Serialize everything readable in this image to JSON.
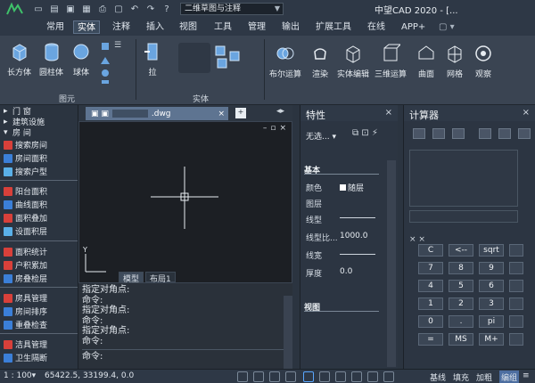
{
  "titlebar": {
    "workspace": "二维草图与注释",
    "app_title": "中望CAD 2020 - [..."
  },
  "menu": {
    "items": [
      "常用",
      "实体",
      "注释",
      "插入",
      "视图",
      "工具",
      "管理",
      "输出",
      "扩展工具",
      "在线",
      "APP+"
    ],
    "active_index": 1
  },
  "ribbon": {
    "primitives": [
      "长方体",
      "圆柱体",
      "球体"
    ],
    "primitives_group": "图元",
    "solid_extrude": "拉",
    "solid_group": "实体",
    "right_buttons": [
      "布尔运算",
      "渲染",
      "实体编辑",
      "三维运算",
      "曲面",
      "网格",
      "观察"
    ]
  },
  "left_palette": {
    "items": [
      "门  窗",
      "建筑设施",
      "房  间",
      "搜索房间",
      "房间面积",
      "搜索户型",
      "阳台面积",
      "曲线面积",
      "面积叠加",
      "设面积层",
      "面积统计",
      "户积累加",
      "房叠检层",
      "房具管理",
      "房间排序",
      "重叠检查",
      "洁具管理",
      "卫生隔断"
    ]
  },
  "document": {
    "tab_label": ".dwg",
    "layout_tabs": [
      "模型",
      "布局1"
    ]
  },
  "command_line": {
    "lines": [
      "指定对角点:",
      "命令:",
      "指定对角点:",
      "命令:",
      "指定对角点:",
      "命令:"
    ],
    "prompt": "命令:"
  },
  "properties": {
    "title": "特性",
    "selection": "无选...",
    "basic_section": "基本",
    "rows": [
      {
        "label": "颜色",
        "value": "随层"
      },
      {
        "label": "图层",
        "value": ""
      },
      {
        "label": "线型",
        "value": ""
      },
      {
        "label": "线型比...",
        "value": "1000.0"
      },
      {
        "label": "线宽",
        "value": ""
      },
      {
        "label": "厚度",
        "value": "0.0"
      }
    ],
    "view_section": "视图"
  },
  "calculator": {
    "title": "计算器",
    "buttons": [
      [
        "C",
        "<--",
        "sqrt"
      ],
      [
        "7",
        "8",
        "9"
      ],
      [
        "4",
        "5",
        "6"
      ],
      [
        "1",
        "2",
        "3"
      ],
      [
        "0",
        ".",
        "pi"
      ],
      [
        "=",
        "MS",
        "M+"
      ]
    ],
    "small_label": "×  ×"
  },
  "statusbar": {
    "scale": "1 : 100",
    "coords": "65422.5, 33199.4, 0.0",
    "right_labels": [
      "基线",
      "填充",
      "加粗",
      "编组"
    ]
  },
  "colors": {
    "accent_green": "#3fc26a",
    "ribbon_bg": "#3a4452",
    "canvas_bg": "#1c1f24"
  }
}
